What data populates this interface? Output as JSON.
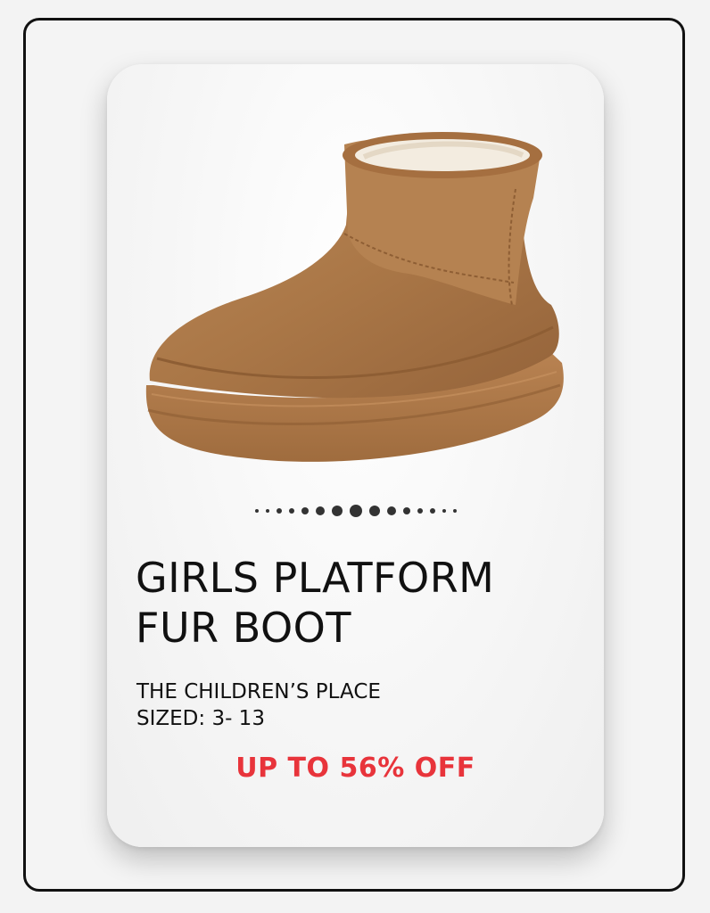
{
  "product": {
    "title_line1": "GIRLS PLATFORM",
    "title_line2": "FUR BOOT",
    "brand": "THE CHILDREN’S PLACE",
    "sizes": "SIZED: 3- 13",
    "offer": "UP TO 56% OFF"
  },
  "carousel": {
    "total": 15,
    "active": 7
  },
  "colors": {
    "offer": "#e8343b",
    "boot": "#b07c4c",
    "frame": "#111111"
  }
}
